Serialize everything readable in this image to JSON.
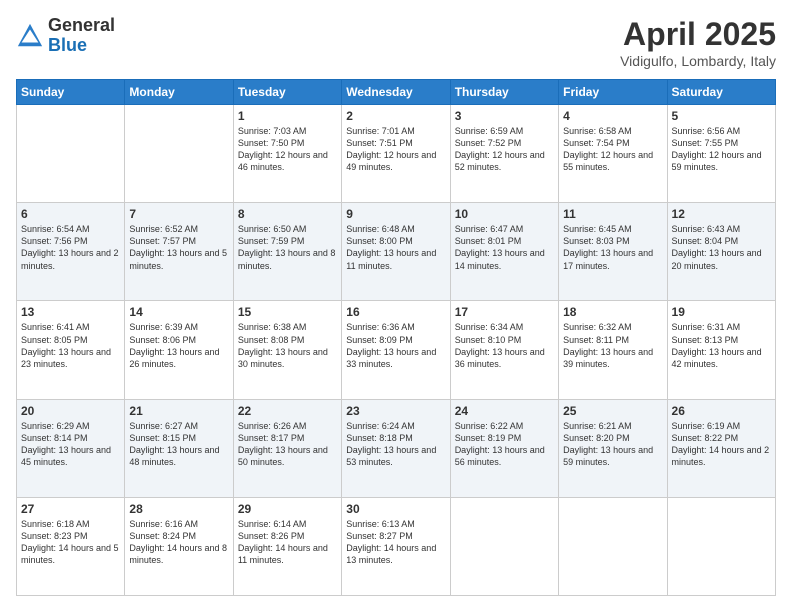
{
  "header": {
    "logo_general": "General",
    "logo_blue": "Blue",
    "title": "April 2025",
    "location": "Vidigulfo, Lombardy, Italy"
  },
  "weekdays": [
    "Sunday",
    "Monday",
    "Tuesday",
    "Wednesday",
    "Thursday",
    "Friday",
    "Saturday"
  ],
  "weeks": [
    [
      {
        "day": "",
        "sunrise": "",
        "sunset": "",
        "daylight": ""
      },
      {
        "day": "",
        "sunrise": "",
        "sunset": "",
        "daylight": ""
      },
      {
        "day": "1",
        "sunrise": "Sunrise: 7:03 AM",
        "sunset": "Sunset: 7:50 PM",
        "daylight": "Daylight: 12 hours and 46 minutes."
      },
      {
        "day": "2",
        "sunrise": "Sunrise: 7:01 AM",
        "sunset": "Sunset: 7:51 PM",
        "daylight": "Daylight: 12 hours and 49 minutes."
      },
      {
        "day": "3",
        "sunrise": "Sunrise: 6:59 AM",
        "sunset": "Sunset: 7:52 PM",
        "daylight": "Daylight: 12 hours and 52 minutes."
      },
      {
        "day": "4",
        "sunrise": "Sunrise: 6:58 AM",
        "sunset": "Sunset: 7:54 PM",
        "daylight": "Daylight: 12 hours and 55 minutes."
      },
      {
        "day": "5",
        "sunrise": "Sunrise: 6:56 AM",
        "sunset": "Sunset: 7:55 PM",
        "daylight": "Daylight: 12 hours and 59 minutes."
      }
    ],
    [
      {
        "day": "6",
        "sunrise": "Sunrise: 6:54 AM",
        "sunset": "Sunset: 7:56 PM",
        "daylight": "Daylight: 13 hours and 2 minutes."
      },
      {
        "day": "7",
        "sunrise": "Sunrise: 6:52 AM",
        "sunset": "Sunset: 7:57 PM",
        "daylight": "Daylight: 13 hours and 5 minutes."
      },
      {
        "day": "8",
        "sunrise": "Sunrise: 6:50 AM",
        "sunset": "Sunset: 7:59 PM",
        "daylight": "Daylight: 13 hours and 8 minutes."
      },
      {
        "day": "9",
        "sunrise": "Sunrise: 6:48 AM",
        "sunset": "Sunset: 8:00 PM",
        "daylight": "Daylight: 13 hours and 11 minutes."
      },
      {
        "day": "10",
        "sunrise": "Sunrise: 6:47 AM",
        "sunset": "Sunset: 8:01 PM",
        "daylight": "Daylight: 13 hours and 14 minutes."
      },
      {
        "day": "11",
        "sunrise": "Sunrise: 6:45 AM",
        "sunset": "Sunset: 8:03 PM",
        "daylight": "Daylight: 13 hours and 17 minutes."
      },
      {
        "day": "12",
        "sunrise": "Sunrise: 6:43 AM",
        "sunset": "Sunset: 8:04 PM",
        "daylight": "Daylight: 13 hours and 20 minutes."
      }
    ],
    [
      {
        "day": "13",
        "sunrise": "Sunrise: 6:41 AM",
        "sunset": "Sunset: 8:05 PM",
        "daylight": "Daylight: 13 hours and 23 minutes."
      },
      {
        "day": "14",
        "sunrise": "Sunrise: 6:39 AM",
        "sunset": "Sunset: 8:06 PM",
        "daylight": "Daylight: 13 hours and 26 minutes."
      },
      {
        "day": "15",
        "sunrise": "Sunrise: 6:38 AM",
        "sunset": "Sunset: 8:08 PM",
        "daylight": "Daylight: 13 hours and 30 minutes."
      },
      {
        "day": "16",
        "sunrise": "Sunrise: 6:36 AM",
        "sunset": "Sunset: 8:09 PM",
        "daylight": "Daylight: 13 hours and 33 minutes."
      },
      {
        "day": "17",
        "sunrise": "Sunrise: 6:34 AM",
        "sunset": "Sunset: 8:10 PM",
        "daylight": "Daylight: 13 hours and 36 minutes."
      },
      {
        "day": "18",
        "sunrise": "Sunrise: 6:32 AM",
        "sunset": "Sunset: 8:11 PM",
        "daylight": "Daylight: 13 hours and 39 minutes."
      },
      {
        "day": "19",
        "sunrise": "Sunrise: 6:31 AM",
        "sunset": "Sunset: 8:13 PM",
        "daylight": "Daylight: 13 hours and 42 minutes."
      }
    ],
    [
      {
        "day": "20",
        "sunrise": "Sunrise: 6:29 AM",
        "sunset": "Sunset: 8:14 PM",
        "daylight": "Daylight: 13 hours and 45 minutes."
      },
      {
        "day": "21",
        "sunrise": "Sunrise: 6:27 AM",
        "sunset": "Sunset: 8:15 PM",
        "daylight": "Daylight: 13 hours and 48 minutes."
      },
      {
        "day": "22",
        "sunrise": "Sunrise: 6:26 AM",
        "sunset": "Sunset: 8:17 PM",
        "daylight": "Daylight: 13 hours and 50 minutes."
      },
      {
        "day": "23",
        "sunrise": "Sunrise: 6:24 AM",
        "sunset": "Sunset: 8:18 PM",
        "daylight": "Daylight: 13 hours and 53 minutes."
      },
      {
        "day": "24",
        "sunrise": "Sunrise: 6:22 AM",
        "sunset": "Sunset: 8:19 PM",
        "daylight": "Daylight: 13 hours and 56 minutes."
      },
      {
        "day": "25",
        "sunrise": "Sunrise: 6:21 AM",
        "sunset": "Sunset: 8:20 PM",
        "daylight": "Daylight: 13 hours and 59 minutes."
      },
      {
        "day": "26",
        "sunrise": "Sunrise: 6:19 AM",
        "sunset": "Sunset: 8:22 PM",
        "daylight": "Daylight: 14 hours and 2 minutes."
      }
    ],
    [
      {
        "day": "27",
        "sunrise": "Sunrise: 6:18 AM",
        "sunset": "Sunset: 8:23 PM",
        "daylight": "Daylight: 14 hours and 5 minutes."
      },
      {
        "day": "28",
        "sunrise": "Sunrise: 6:16 AM",
        "sunset": "Sunset: 8:24 PM",
        "daylight": "Daylight: 14 hours and 8 minutes."
      },
      {
        "day": "29",
        "sunrise": "Sunrise: 6:14 AM",
        "sunset": "Sunset: 8:26 PM",
        "daylight": "Daylight: 14 hours and 11 minutes."
      },
      {
        "day": "30",
        "sunrise": "Sunrise: 6:13 AM",
        "sunset": "Sunset: 8:27 PM",
        "daylight": "Daylight: 14 hours and 13 minutes."
      },
      {
        "day": "",
        "sunrise": "",
        "sunset": "",
        "daylight": ""
      },
      {
        "day": "",
        "sunrise": "",
        "sunset": "",
        "daylight": ""
      },
      {
        "day": "",
        "sunrise": "",
        "sunset": "",
        "daylight": ""
      }
    ]
  ]
}
